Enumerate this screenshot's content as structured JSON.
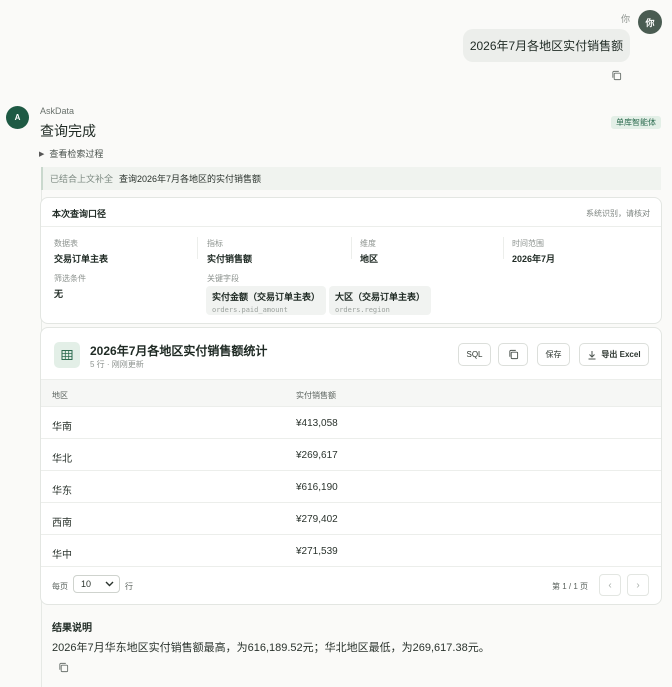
{
  "user": {
    "name": "你",
    "avatar_text": "你",
    "message": "2026年7月各地区实付销售额"
  },
  "assistant": {
    "avatar_text": "A",
    "name": "AskData",
    "status_title": "查询完成",
    "agent_badge": "单库智能体",
    "process_toggle": "查看检索过程",
    "context_tag": "已结合上文补全",
    "context_text": "查询2026年7月各地区的实付销售额"
  },
  "criteria": {
    "title": "本次查询口径",
    "subtitle": "系统识别，请核对",
    "fields": [
      {
        "label": "数据表",
        "value": "交易订单主表"
      },
      {
        "label": "指标",
        "value": "实付销售额"
      },
      {
        "label": "维度",
        "value": "地区"
      },
      {
        "label": "时间范围",
        "value": "2026年7月"
      }
    ],
    "filter": {
      "label": "筛选条件",
      "value": "无"
    },
    "key_fields": {
      "label": "关键字段",
      "items": [
        {
          "cn": "实付金额（交易订单主表）",
          "en": "orders.paid_amount"
        },
        {
          "cn": "大区（交易订单主表）",
          "en": "orders.region"
        }
      ]
    }
  },
  "result": {
    "title": "2026年7月各地区实付销售额统计",
    "subtitle": "5 行 · 刚刚更新",
    "buttons": {
      "sql": "SQL",
      "save": "保存",
      "export": "导出 Excel"
    },
    "columns": [
      "地区",
      "实付销售额"
    ],
    "rows": [
      [
        "华南",
        "¥413,058"
      ],
      [
        "华北",
        "¥269,617"
      ],
      [
        "华东",
        "¥616,190"
      ],
      [
        "西南",
        "¥279,402"
      ],
      [
        "华中",
        "¥271,539"
      ]
    ],
    "pager": {
      "per_page_label": "每页",
      "per_page_value": "10",
      "rows_label": "行",
      "page_info": "第 1 / 1 页",
      "prev": "‹",
      "next": "›"
    }
  },
  "explanation": {
    "title": "结果说明",
    "text": "2026年7月华东地区实付销售额最高，为616,189.52元；华北地区最低，为269,617.38元。"
  },
  "colors": {
    "accent": "#1e5a44",
    "badge_bg": "#e3efe7"
  },
  "icons": [
    "copy-icon",
    "table-icon",
    "download-icon",
    "chevron-down-icon",
    "caret-right-icon"
  ]
}
